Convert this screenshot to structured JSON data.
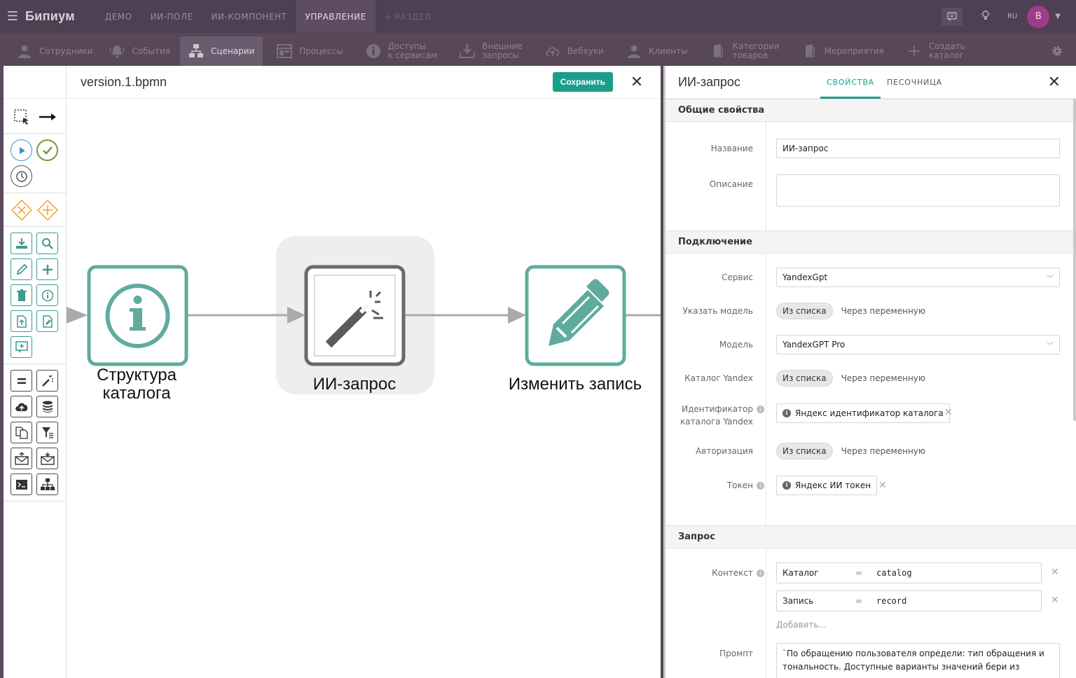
{
  "topbar": {
    "logo": "Бипиум",
    "nav": [
      "ДЕМО",
      "ИИ-ПОЛЕ",
      "ИИ-КОМПОНЕНТ",
      "УПРАВЛЕНИЕ",
      "+ РАЗДЕЛ"
    ],
    "active_nav": "УПРАВЛЕНИЕ",
    "lang": "RU",
    "avatar_letter": "B"
  },
  "subnav": {
    "items": [
      {
        "label": "Сотрудники",
        "icon": "user-icon"
      },
      {
        "label": "События",
        "icon": "bell-icon"
      },
      {
        "label": "Сценарии",
        "icon": "sitemap-icon"
      },
      {
        "label": "Процессы",
        "icon": "window-icon"
      },
      {
        "label": "Доступы\nк сервисам",
        "icon": "info-icon"
      },
      {
        "label": "Внешние\nзапросы",
        "icon": "download-icon"
      },
      {
        "label": "Вебхуки",
        "icon": "cloud-icon"
      },
      {
        "label": "Клиенты",
        "icon": "user-icon"
      },
      {
        "label": "Категории\nтоваров",
        "icon": "book-icon"
      },
      {
        "label": "Мероприятия",
        "icon": "book-icon"
      },
      {
        "label": "Создать\nкаталог",
        "icon": "plus-icon"
      }
    ],
    "active": "Сценарии"
  },
  "editor": {
    "filename": "version.1.bpmn",
    "save_label": "Сохранить",
    "nodes": [
      {
        "label": "Структура каталога",
        "icon": "info-icon"
      },
      {
        "label": "ИИ-запрос",
        "icon": "magic-wand-icon"
      },
      {
        "label": "Изменить запись",
        "icon": "pencil-icon"
      }
    ]
  },
  "panel": {
    "title": "ИИ-запрос",
    "tabs": [
      "СВОЙСТВА",
      "ПЕСОЧНИЦА"
    ],
    "active_tab": "СВОЙСТВА",
    "sections": {
      "general": {
        "title": "Общие свойства",
        "name_label": "Название",
        "name_value": "ИИ-запрос",
        "description_label": "Описание",
        "description_value": ""
      },
      "connection": {
        "title": "Подключение",
        "service_label": "Сервис",
        "service_value": "YandexGpt",
        "model_mode_label": "Указать модель",
        "model_label": "Модель",
        "model_value": "YandexGPT Pro",
        "catalog_label": "Каталог Yandex",
        "catalog_id_label": "Идентификатор каталога Yandex",
        "catalog_id_value": "Яндекс идентификатор каталога",
        "auth_label": "Авторизация",
        "token_label": "Токен",
        "token_value": "Яндекс ИИ токен",
        "opt_list": "Из списка",
        "opt_var": "Через переменную"
      },
      "request": {
        "title": "Запрос",
        "context_label": "Контекст",
        "context": [
          {
            "key": "Каталог",
            "eq": "=",
            "value": "catalog"
          },
          {
            "key": "Запись",
            "eq": "=",
            "value": "record"
          }
        ],
        "add_label": "Добавить...",
        "prompt_label": "Промпт",
        "prompt_value": "`По обращению пользователя определи: тип обращения и тональность. Доступные варианты значений бери из структуры"
      }
    }
  },
  "colors": {
    "teal": "#1a9e8a",
    "node_teal": "#5fac9e",
    "topbar": "#4f3f52",
    "subbar": "#574759",
    "avatar": "#a03b8a"
  }
}
